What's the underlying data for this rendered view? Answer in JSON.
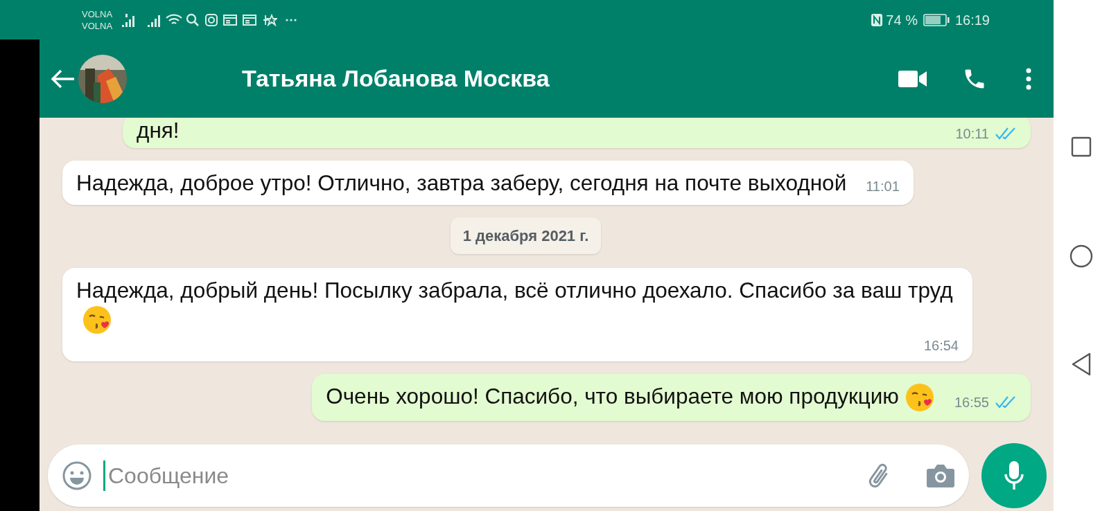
{
  "status_bar": {
    "carriers": [
      "VOLNA",
      "VOLNA"
    ],
    "battery": "74 %",
    "time": "16:19"
  },
  "header": {
    "title": "Татьяна Лобанова Москва"
  },
  "messages": [
    {
      "kind": "outgoing",
      "text": "дня!",
      "time": "10:11",
      "read": true,
      "emoji": false
    },
    {
      "kind": "incoming",
      "text": "Надежда, доброе утро! Отлично, завтра заберу, сегодня на почте  выходной",
      "time": "11:01",
      "emoji": false
    },
    {
      "kind": "date",
      "text": "1 декабря 2021 г."
    },
    {
      "kind": "incoming",
      "text": "Надежда, добрый день! Посылку забрала, всё отлично доехало. Спасибо за ваш труд",
      "time": "16:54",
      "emoji": true
    },
    {
      "kind": "outgoing",
      "text": "Очень хорошо! Спасибо, что выбираете мою продукцию",
      "time": "16:55",
      "read": true,
      "emoji": true
    }
  ],
  "composer": {
    "placeholder": "Сообщение"
  }
}
